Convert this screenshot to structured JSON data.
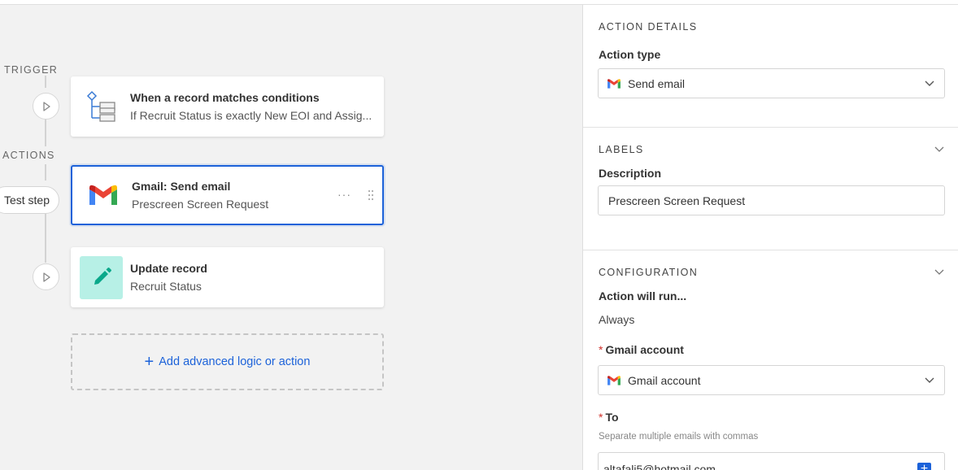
{
  "canvas": {
    "trigger_label": "TRIGGER",
    "actions_label": "ACTIONS",
    "test_step_label": "Test step",
    "trigger_card": {
      "title": "When a record matches conditions",
      "subtitle": "If Recruit Status is exactly New EOI and Assig..."
    },
    "gmail_card": {
      "title": "Gmail: Send email",
      "subtitle": "Prescreen Screen Request",
      "more_label": "···"
    },
    "update_card": {
      "title": "Update record",
      "subtitle": "Recruit Status"
    },
    "add_label": "Add advanced logic or action",
    "add_plus": "+"
  },
  "panel": {
    "action_details": {
      "heading": "ACTION DETAILS",
      "action_type_label": "Action type",
      "action_type_value": "Send email"
    },
    "labels": {
      "heading": "LABELS",
      "description_label": "Description",
      "description_value": "Prescreen Screen Request"
    },
    "configuration": {
      "heading": "CONFIGURATION",
      "run_label": "Action will run...",
      "run_value": "Always",
      "required_mark": "*",
      "gmail_account_label": "Gmail account",
      "gmail_account_value": "Gmail account",
      "to_label": "To",
      "to_hint": "Separate multiple emails with commas",
      "to_value": "altafali5@hotmail.com",
      "insert_symbol": "+"
    }
  },
  "colors": {
    "accent": "#1c62d9",
    "update_icon_bg": "#b7f0e6",
    "update_icon_fg": "#0aa88a",
    "required": "#d0302a"
  }
}
